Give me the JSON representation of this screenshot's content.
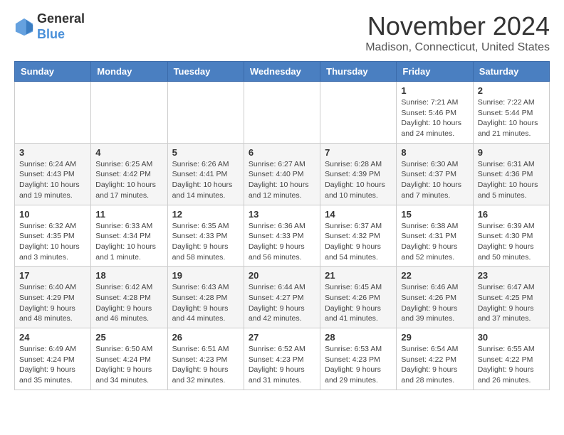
{
  "logo": {
    "general": "General",
    "blue": "Blue"
  },
  "title": "November 2024",
  "location": "Madison, Connecticut, United States",
  "days_of_week": [
    "Sunday",
    "Monday",
    "Tuesday",
    "Wednesday",
    "Thursday",
    "Friday",
    "Saturday"
  ],
  "weeks": [
    [
      {
        "day": "",
        "info": ""
      },
      {
        "day": "",
        "info": ""
      },
      {
        "day": "",
        "info": ""
      },
      {
        "day": "",
        "info": ""
      },
      {
        "day": "",
        "info": ""
      },
      {
        "day": "1",
        "info": "Sunrise: 7:21 AM\nSunset: 5:46 PM\nDaylight: 10 hours and 24 minutes."
      },
      {
        "day": "2",
        "info": "Sunrise: 7:22 AM\nSunset: 5:44 PM\nDaylight: 10 hours and 21 minutes."
      }
    ],
    [
      {
        "day": "3",
        "info": "Sunrise: 6:24 AM\nSunset: 4:43 PM\nDaylight: 10 hours and 19 minutes."
      },
      {
        "day": "4",
        "info": "Sunrise: 6:25 AM\nSunset: 4:42 PM\nDaylight: 10 hours and 17 minutes."
      },
      {
        "day": "5",
        "info": "Sunrise: 6:26 AM\nSunset: 4:41 PM\nDaylight: 10 hours and 14 minutes."
      },
      {
        "day": "6",
        "info": "Sunrise: 6:27 AM\nSunset: 4:40 PM\nDaylight: 10 hours and 12 minutes."
      },
      {
        "day": "7",
        "info": "Sunrise: 6:28 AM\nSunset: 4:39 PM\nDaylight: 10 hours and 10 minutes."
      },
      {
        "day": "8",
        "info": "Sunrise: 6:30 AM\nSunset: 4:37 PM\nDaylight: 10 hours and 7 minutes."
      },
      {
        "day": "9",
        "info": "Sunrise: 6:31 AM\nSunset: 4:36 PM\nDaylight: 10 hours and 5 minutes."
      }
    ],
    [
      {
        "day": "10",
        "info": "Sunrise: 6:32 AM\nSunset: 4:35 PM\nDaylight: 10 hours and 3 minutes."
      },
      {
        "day": "11",
        "info": "Sunrise: 6:33 AM\nSunset: 4:34 PM\nDaylight: 10 hours and 1 minute."
      },
      {
        "day": "12",
        "info": "Sunrise: 6:35 AM\nSunset: 4:33 PM\nDaylight: 9 hours and 58 minutes."
      },
      {
        "day": "13",
        "info": "Sunrise: 6:36 AM\nSunset: 4:33 PM\nDaylight: 9 hours and 56 minutes."
      },
      {
        "day": "14",
        "info": "Sunrise: 6:37 AM\nSunset: 4:32 PM\nDaylight: 9 hours and 54 minutes."
      },
      {
        "day": "15",
        "info": "Sunrise: 6:38 AM\nSunset: 4:31 PM\nDaylight: 9 hours and 52 minutes."
      },
      {
        "day": "16",
        "info": "Sunrise: 6:39 AM\nSunset: 4:30 PM\nDaylight: 9 hours and 50 minutes."
      }
    ],
    [
      {
        "day": "17",
        "info": "Sunrise: 6:40 AM\nSunset: 4:29 PM\nDaylight: 9 hours and 48 minutes."
      },
      {
        "day": "18",
        "info": "Sunrise: 6:42 AM\nSunset: 4:28 PM\nDaylight: 9 hours and 46 minutes."
      },
      {
        "day": "19",
        "info": "Sunrise: 6:43 AM\nSunset: 4:28 PM\nDaylight: 9 hours and 44 minutes."
      },
      {
        "day": "20",
        "info": "Sunrise: 6:44 AM\nSunset: 4:27 PM\nDaylight: 9 hours and 42 minutes."
      },
      {
        "day": "21",
        "info": "Sunrise: 6:45 AM\nSunset: 4:26 PM\nDaylight: 9 hours and 41 minutes."
      },
      {
        "day": "22",
        "info": "Sunrise: 6:46 AM\nSunset: 4:26 PM\nDaylight: 9 hours and 39 minutes."
      },
      {
        "day": "23",
        "info": "Sunrise: 6:47 AM\nSunset: 4:25 PM\nDaylight: 9 hours and 37 minutes."
      }
    ],
    [
      {
        "day": "24",
        "info": "Sunrise: 6:49 AM\nSunset: 4:24 PM\nDaylight: 9 hours and 35 minutes."
      },
      {
        "day": "25",
        "info": "Sunrise: 6:50 AM\nSunset: 4:24 PM\nDaylight: 9 hours and 34 minutes."
      },
      {
        "day": "26",
        "info": "Sunrise: 6:51 AM\nSunset: 4:23 PM\nDaylight: 9 hours and 32 minutes."
      },
      {
        "day": "27",
        "info": "Sunrise: 6:52 AM\nSunset: 4:23 PM\nDaylight: 9 hours and 31 minutes."
      },
      {
        "day": "28",
        "info": "Sunrise: 6:53 AM\nSunset: 4:23 PM\nDaylight: 9 hours and 29 minutes."
      },
      {
        "day": "29",
        "info": "Sunrise: 6:54 AM\nSunset: 4:22 PM\nDaylight: 9 hours and 28 minutes."
      },
      {
        "day": "30",
        "info": "Sunrise: 6:55 AM\nSunset: 4:22 PM\nDaylight: 9 hours and 26 minutes."
      }
    ]
  ]
}
